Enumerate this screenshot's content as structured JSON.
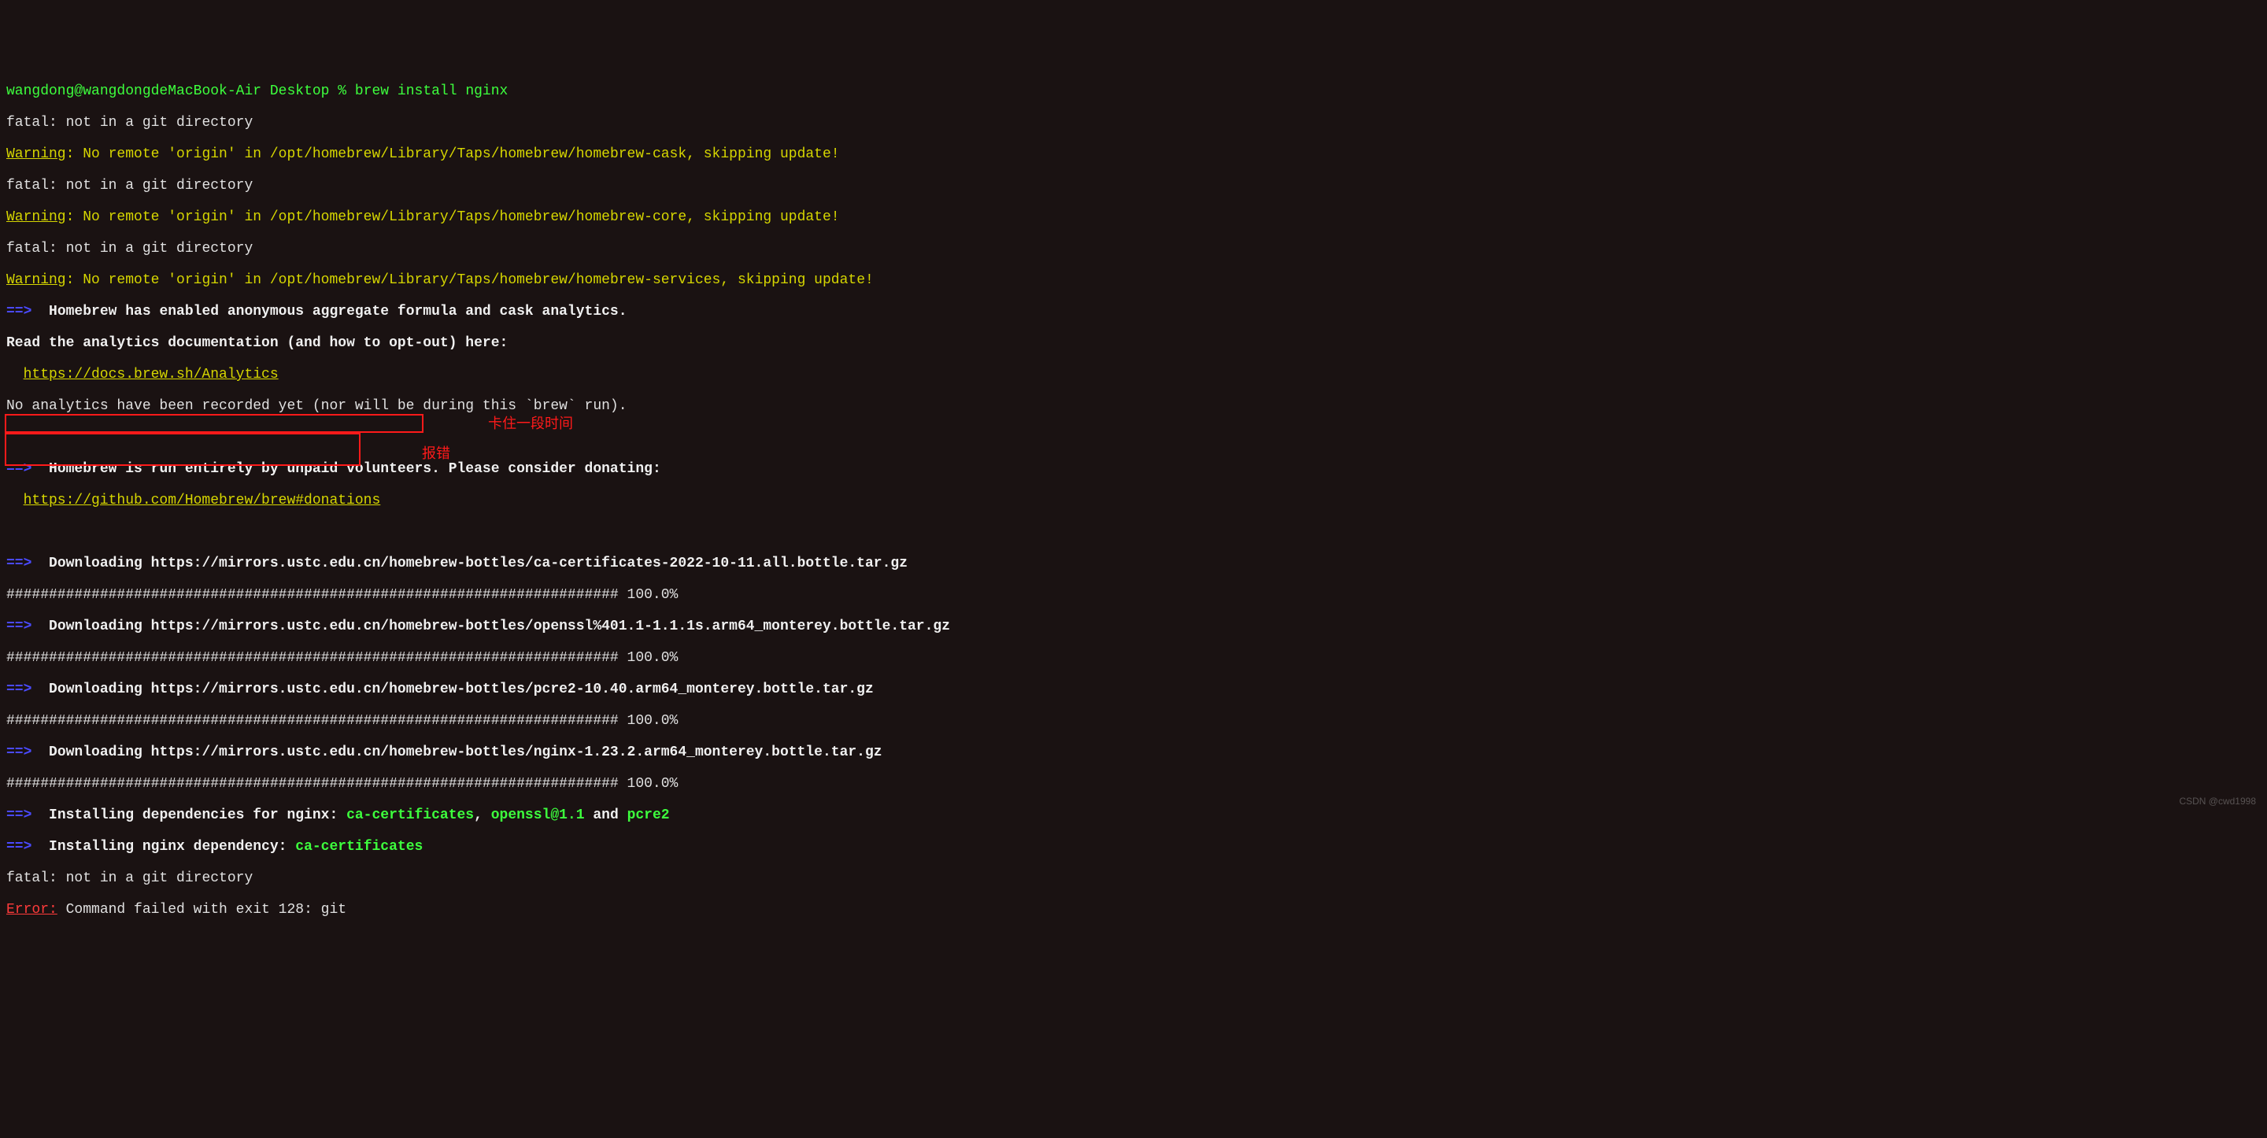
{
  "prompt": {
    "user_host": "wangdong@wangdongdeMacBook-Air",
    "cwd": "Desktop",
    "sep": " % ",
    "command": "brew install nginx"
  },
  "fatal": "fatal: not in a git directory",
  "warning_label": "Warning",
  "warnings": [
    ": No remote 'origin' in /opt/homebrew/Library/Taps/homebrew/homebrew-cask, skipping update!",
    ": No remote 'origin' in /opt/homebrew/Library/Taps/homebrew/homebrew-core, skipping update!",
    ": No remote 'origin' in /opt/homebrew/Library/Taps/homebrew/homebrew-services, skipping update!"
  ],
  "arrow": "==>",
  "analytics": {
    "head": "Homebrew has enabled anonymous aggregate formula and cask analytics.",
    "read": "Read the analytics documentation (and how to opt-out) here:",
    "url": "https://docs.brew.sh/Analytics",
    "none": "No analytics have been recorded yet (nor will be during this `brew` run)."
  },
  "donate": {
    "head": "Homebrew is run entirely by unpaid volunteers. Please consider donating:",
    "url": "https://github.com/Homebrew/brew#donations"
  },
  "downloads": [
    "Downloading https://mirrors.ustc.edu.cn/homebrew-bottles/ca-certificates-2022-10-11.all.bottle.tar.gz",
    "Downloading https://mirrors.ustc.edu.cn/homebrew-bottles/openssl%401.1-1.1.1s.arm64_monterey.bottle.tar.gz",
    "Downloading https://mirrors.ustc.edu.cn/homebrew-bottles/pcre2-10.40.arm64_monterey.bottle.tar.gz",
    "Downloading https://mirrors.ustc.edu.cn/homebrew-bottles/nginx-1.23.2.arm64_monterey.bottle.tar.gz"
  ],
  "progress": "######################################################################## 100.0%",
  "deps_line": {
    "label": "Installing dependencies for nginx: ",
    "list": "ca-certificates",
    "mid": ", ",
    "list2": "openssl@1.1",
    "and": " and ",
    "list3": "pcre2"
  },
  "install_dep": {
    "label": "Installing nginx dependency: ",
    "name": "ca-certificates"
  },
  "error_label": "Error:",
  "error_msg": " Command failed with exit 128: git",
  "annotations": {
    "stuck": "卡住一段时间",
    "error": "报错"
  },
  "watermark": "CSDN @cwd1998"
}
